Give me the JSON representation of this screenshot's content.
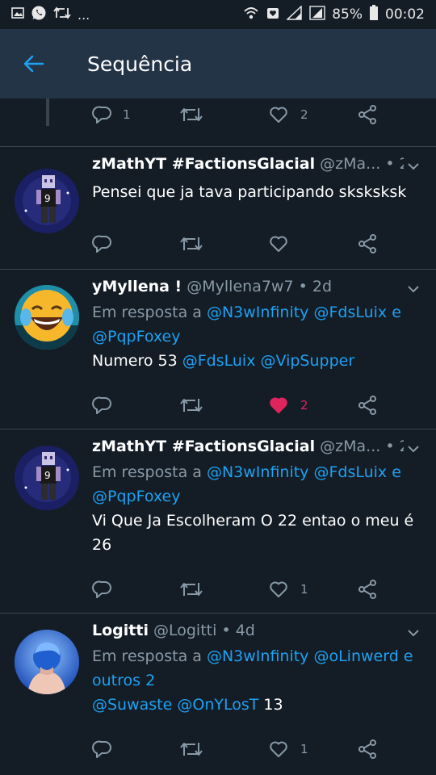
{
  "status_bar": {
    "icons_left": [
      "image-icon",
      "whatsapp-icon",
      "retweet-icon"
    ],
    "more": "...",
    "icons_right": [
      "wifi-icon",
      "alarm-icon",
      "signal-icon",
      "signal-icon"
    ],
    "battery": "85%",
    "time": "00:02"
  },
  "header": {
    "title": "Sequência"
  },
  "colors": {
    "accent": "#1da1f2",
    "like": "#e0245e",
    "muted": "#8899a6",
    "bg": "#141d26",
    "bar": "#243447"
  },
  "prev_tweet": {
    "replies": "1",
    "retweets": "",
    "likes": "2"
  },
  "tweets": [
    {
      "name": "zMathYT #FactionsGlacial",
      "handle": "@zMa...",
      "time": "• 2d",
      "text": "Pensei que ja tava participando sksksksk",
      "replies": "",
      "retweets": "",
      "likes": ""
    },
    {
      "name": "yMyllena !",
      "handle": "@Myllena7w7",
      "time": "• 2d",
      "reply_prefix": "Em resposta a",
      "reply_to_1": "@N3wInfinity",
      "reply_to_2": "@FdsLuix",
      "reply_join": "e",
      "reply_to_3": "@PqpFoxey",
      "text_prefix": "Numero 53",
      "mention_1": "@FdsLuix",
      "mention_2": "@VipSupper",
      "replies": "",
      "retweets": "",
      "likes": "2"
    },
    {
      "name": "zMathYT #FactionsGlacial",
      "handle": "@zMa...",
      "time": "• 2d",
      "reply_prefix": "Em resposta a",
      "reply_to_1": "@N3wInfinity",
      "reply_to_2": "@FdsLuix",
      "reply_join": "e",
      "reply_to_3": "@PqpFoxey",
      "text_line1": "Vi Que Ja Escolheram O 22 entao o meu é",
      "text_line2": "26",
      "replies": "",
      "retweets": "",
      "likes": "1"
    },
    {
      "name": "Logitti",
      "handle": "@Logitti",
      "time": "• 4d",
      "reply_prefix": "Em resposta a",
      "reply_to_1": "@N3wInfinity",
      "reply_to_2": "@oLinwerd",
      "reply_join": "e",
      "reply_others": "outros 2",
      "mention_1": "@Suwaste",
      "mention_2": "@OnYLosT",
      "text_suffix": "13",
      "replies": "",
      "retweets": "",
      "likes": "1"
    }
  ]
}
